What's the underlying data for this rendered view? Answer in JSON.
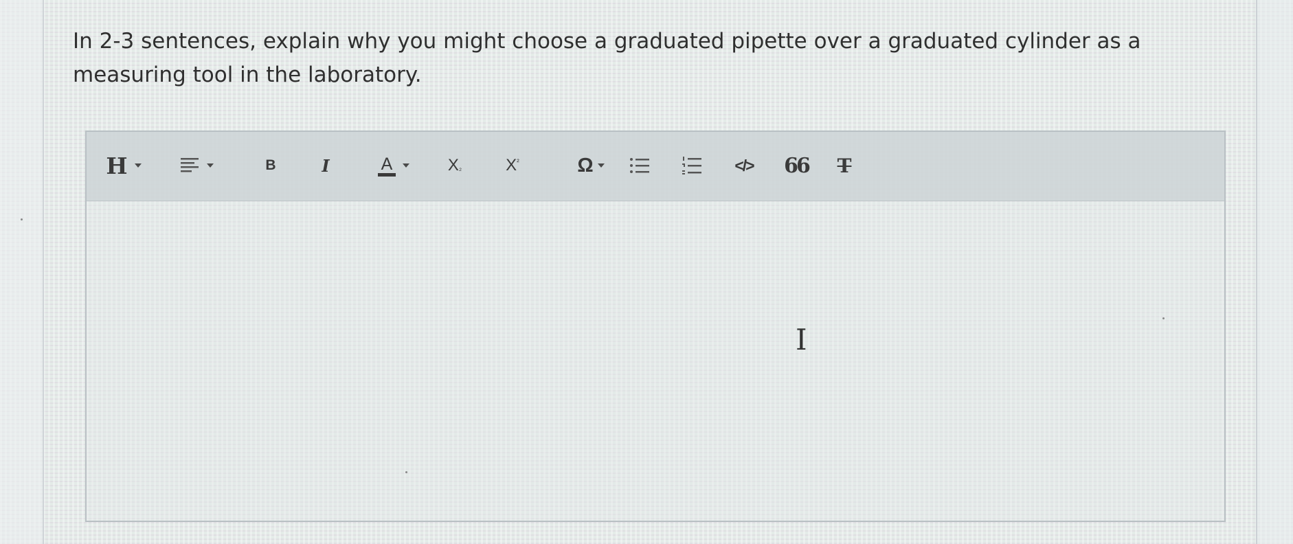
{
  "question": {
    "text": "In 2-3 sentences, explain why you might choose a graduated pipette over a graduated cylinder as a measuring tool in the laboratory."
  },
  "toolbar": {
    "heading_label": "H",
    "bold_label": "B",
    "italic_label": "I",
    "font_color_label": "A",
    "subscript_base": "X",
    "subscript_mark": "₂",
    "superscript_base": "X",
    "superscript_mark": "²",
    "special_char_label": "Ω",
    "code_label": "</>",
    "blockquote_label": "66",
    "clear_format_label": "T"
  },
  "editor": {
    "value": ""
  },
  "icons": {
    "heading": "heading-icon",
    "align": "align-icon",
    "bullet_list": "bullet-list-icon",
    "numbered_list": "numbered-list-icon",
    "clear_format": "clear-format-icon",
    "text_cursor": "text-cursor-icon"
  },
  "colors": {
    "toolbar_bg": "#cdd4d6",
    "editor_border": "#b9c0c4",
    "text": "#2f2f2f"
  }
}
